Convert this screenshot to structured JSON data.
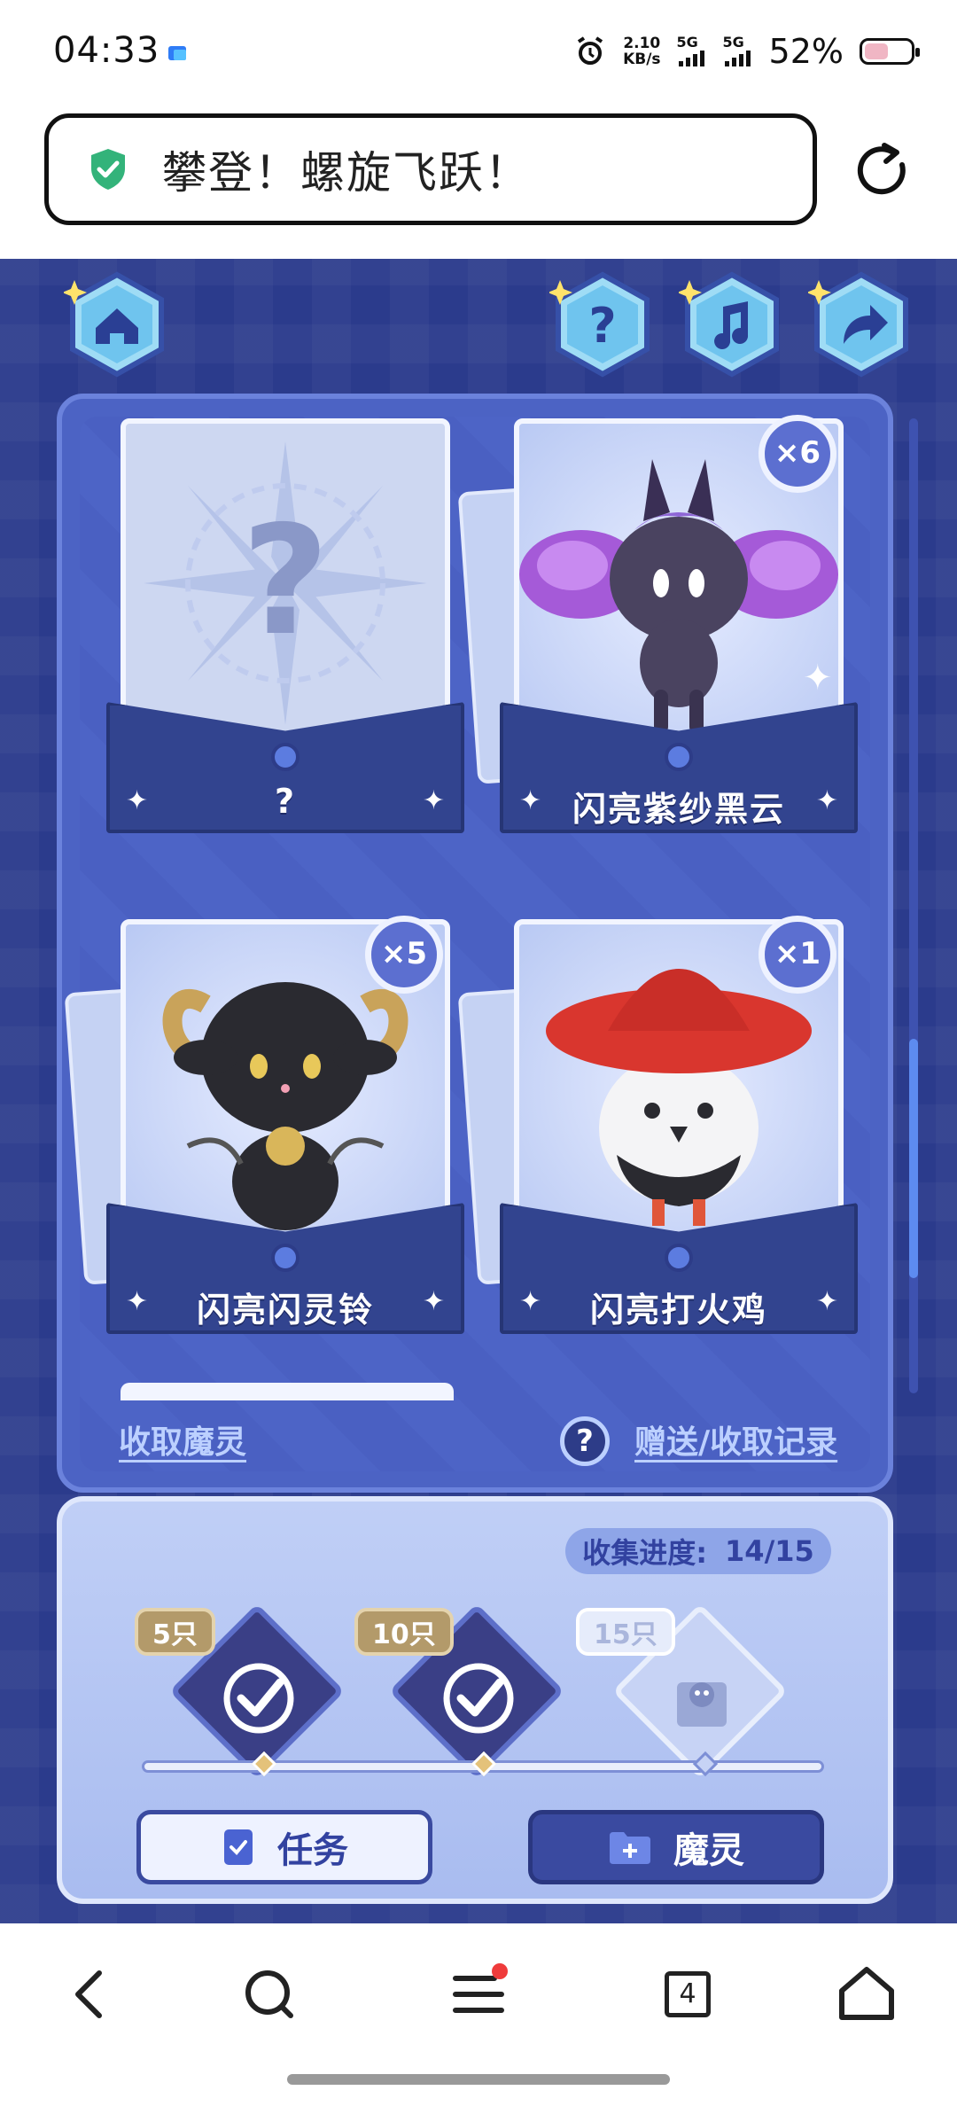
{
  "status": {
    "time": "04:33",
    "net_speed": "2.10",
    "net_unit": "KB/s",
    "sig1": "5G",
    "sig2": "5G",
    "battery": "52%",
    "battery_level": 0.52
  },
  "browser": {
    "page_title": "攀登！螺旋飞跃！"
  },
  "cards": [
    {
      "name": "?",
      "count": null,
      "locked": true
    },
    {
      "name": "闪亮紫纱黑云",
      "count": "×6",
      "locked": false
    },
    {
      "name": "闪亮闪灵铃",
      "count": "×5",
      "locked": false
    },
    {
      "name": "闪亮打火鸡",
      "count": "×1",
      "locked": false
    }
  ],
  "links": {
    "collect": "收取魔灵",
    "help_symbol": "?",
    "records": "赠送/收取记录"
  },
  "progress": {
    "label": "收集进度:",
    "value": "14/15",
    "fraction": 0.9333,
    "rewards": [
      {
        "tag": "5只",
        "claimed": true
      },
      {
        "tag": "10只",
        "claimed": true
      },
      {
        "tag": "15只",
        "claimed": false
      }
    ]
  },
  "buttons": {
    "tasks": "任务",
    "spirits": "魔灵"
  },
  "navbar": {
    "tabs_count": "4"
  }
}
